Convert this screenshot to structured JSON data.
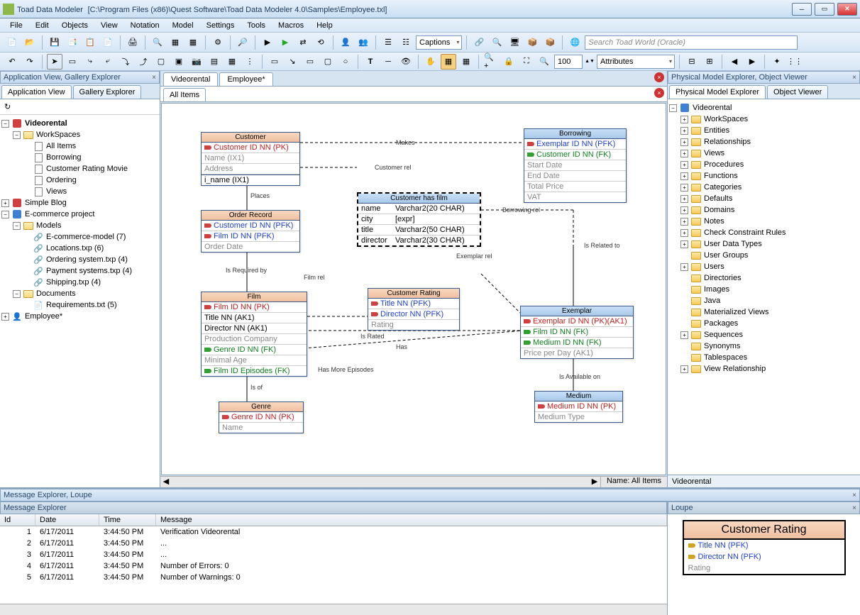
{
  "titlebar": {
    "app": "Toad Data Modeler",
    "path": "[C:\\Program Files (x86)\\Quest Software\\Toad Data Modeler 4.0\\Samples\\Employee.txl]"
  },
  "menu": [
    "File",
    "Edit",
    "Objects",
    "View",
    "Notation",
    "Model",
    "Settings",
    "Tools",
    "Macros",
    "Help"
  ],
  "toolbar": {
    "combo_captions": "Captions",
    "search_placeholder": "Search Toad World (Oracle)",
    "zoom": "100",
    "combo_attributes": "Attributes"
  },
  "left": {
    "header": "Application View, Gallery Explorer",
    "tabs": [
      "Application View",
      "Gallery Explorer"
    ],
    "tree": {
      "videorental": "Videorental",
      "workspaces": "WorkSpaces",
      "ws_items": [
        "All Items",
        "Borrowing",
        "Customer Rating Movie",
        "Ordering",
        "Views"
      ],
      "simple_blog": "Simple Blog",
      "ecommerce": "E-commerce project",
      "models": "Models",
      "model_items": [
        "E-commerce-model (7)",
        "Locations.txp (6)",
        "Ordering system.txp (4)",
        "Payment systems.txp (4)",
        "Shipping.txp (4)"
      ],
      "documents": "Documents",
      "doc_items": [
        "Requirements.txt (5)"
      ],
      "employee": "Employee*"
    }
  },
  "center": {
    "doctabs": [
      "Videorental",
      "Employee*"
    ],
    "subtab": "All Items",
    "status": "Name: All Items",
    "entities": {
      "customer": {
        "title": "Customer",
        "rows": [
          {
            "txt": "Customer ID NN  (PK)",
            "cls": "pk",
            "key": "red"
          },
          {
            "txt": "Name   (IX1)",
            "cls": "gray"
          },
          {
            "txt": "Address",
            "cls": "gray"
          },
          {
            "txt": "i_name (IX1)",
            "cls": ""
          }
        ]
      },
      "order": {
        "title": "Order Record",
        "rows": [
          {
            "txt": "Customer ID NN   (PFK)",
            "cls": "nn",
            "key": "red"
          },
          {
            "txt": "Film ID NN   (PFK)",
            "cls": "nn",
            "key": "red"
          },
          {
            "txt": "Order Date",
            "cls": "gray"
          }
        ]
      },
      "film": {
        "title": "Film",
        "rows": [
          {
            "txt": "Film ID NN  (PK)",
            "cls": "pk",
            "key": "red"
          },
          {
            "txt": "Title NN (AK1)",
            "cls": ""
          },
          {
            "txt": "Director NN (AK1)",
            "cls": ""
          },
          {
            "txt": "Production Company",
            "cls": "gray"
          },
          {
            "txt": "Genre ID NN   (FK)",
            "cls": "fk",
            "key": "green"
          },
          {
            "txt": "Minimal Age",
            "cls": "gray"
          },
          {
            "txt": "Film ID Episodes   (FK)",
            "cls": "fk",
            "key": "green"
          }
        ]
      },
      "genre": {
        "title": "Genre",
        "rows": [
          {
            "txt": "Genre ID NN  (PK)",
            "cls": "pk",
            "key": "red"
          },
          {
            "txt": "Name",
            "cls": "gray"
          }
        ]
      },
      "custfilm": {
        "title": "Customer has film",
        "rows": [
          {
            "l": "name",
            "r": "Varchar2(20 CHAR)"
          },
          {
            "l": "city",
            "r": "[expr]"
          },
          {
            "l": "title",
            "r": "Varchar2(50 CHAR)"
          },
          {
            "l": "director",
            "r": "Varchar2(30 CHAR)"
          }
        ]
      },
      "rating": {
        "title": "Customer Rating",
        "rows": [
          {
            "txt": "Title NN   (PFK)",
            "cls": "nn",
            "key": "red"
          },
          {
            "txt": "Director NN   (PFK)",
            "cls": "nn",
            "key": "red"
          },
          {
            "txt": "Rating",
            "cls": "gray"
          }
        ]
      },
      "borrowing": {
        "title": "Borrowing",
        "rows": [
          {
            "txt": "Exemplar ID NN   (PFK)",
            "cls": "nn",
            "key": "red"
          },
          {
            "txt": "Customer ID NN   (FK)",
            "cls": "fk",
            "key": "green"
          },
          {
            "txt": "Start Date",
            "cls": "gray"
          },
          {
            "txt": "End Date",
            "cls": "gray"
          },
          {
            "txt": "Total Price",
            "cls": "gray"
          },
          {
            "txt": "VAT",
            "cls": "gray"
          }
        ]
      },
      "exemplar": {
        "title": "Exemplar",
        "rows": [
          {
            "txt": "Exemplar ID NN  (PK)(AK1)",
            "cls": "pk",
            "key": "red"
          },
          {
            "txt": "Film ID NN   (FK)",
            "cls": "fk",
            "key": "green"
          },
          {
            "txt": "Medium ID NN   (FK)",
            "cls": "fk",
            "key": "green"
          },
          {
            "txt": "Price per Day  (AK1)",
            "cls": "gray"
          }
        ]
      },
      "medium": {
        "title": "Medium",
        "rows": [
          {
            "txt": "Medium ID NN  (PK)",
            "cls": "pk",
            "key": "red"
          },
          {
            "txt": "Medium Type",
            "cls": "gray"
          }
        ]
      }
    },
    "labels": {
      "makes": "Makes",
      "custrel": "Customer rel",
      "places": "Places",
      "filmrel": "Film rel",
      "isreq": "Is Required by",
      "isof": "Is of",
      "israted": "Is Rated",
      "has": "Has",
      "hasmoreep": "Has More Episodes",
      "borrowrel": "Borrowing rel",
      "isrelated": "Is Related to",
      "exemplarrel": "Exemplar rel",
      "isavail": "Is Available on"
    }
  },
  "right": {
    "header": "Physical Model Explorer, Object Viewer",
    "tabs": [
      "Physical Model Explorer",
      "Object Viewer"
    ],
    "root": "Videorental",
    "items": [
      "WorkSpaces",
      "Entities",
      "Relationships",
      "Views",
      "Procedures",
      "Functions",
      "Categories",
      "Defaults",
      "Domains",
      "Notes",
      "Check Constraint Rules",
      "User Data Types",
      "User Groups",
      "Users",
      "Directories",
      "Images",
      "Java",
      "Materialized Views",
      "Packages",
      "Sequences",
      "Synonyms",
      "Tablespaces",
      "View Relationship"
    ],
    "status": "Videorental"
  },
  "bottom": {
    "header": "Message Explorer, Loupe",
    "msgheader": "Message Explorer",
    "cols": [
      "Id",
      "Date",
      "Time",
      "Message"
    ],
    "rows": [
      {
        "id": "1",
        "date": "6/17/2011",
        "time": "3:44:50 PM",
        "msg": "Verification Videorental"
      },
      {
        "id": "2",
        "date": "6/17/2011",
        "time": "3:44:50 PM",
        "msg": "..."
      },
      {
        "id": "3",
        "date": "6/17/2011",
        "time": "3:44:50 PM",
        "msg": "..."
      },
      {
        "id": "4",
        "date": "6/17/2011",
        "time": "3:44:50 PM",
        "msg": "Number of Errors: 0"
      },
      {
        "id": "5",
        "date": "6/17/2011",
        "time": "3:44:50 PM",
        "msg": "Number of Warnings: 0"
      }
    ],
    "loupe": {
      "header": "Loupe",
      "title": "Customer Rating",
      "rows": [
        {
          "txt": "Title NN  (PFK)",
          "cls": "nn"
        },
        {
          "txt": "Director NN  (PFK)",
          "cls": "nn"
        },
        {
          "txt": "Rating",
          "cls": "gray"
        }
      ]
    }
  }
}
